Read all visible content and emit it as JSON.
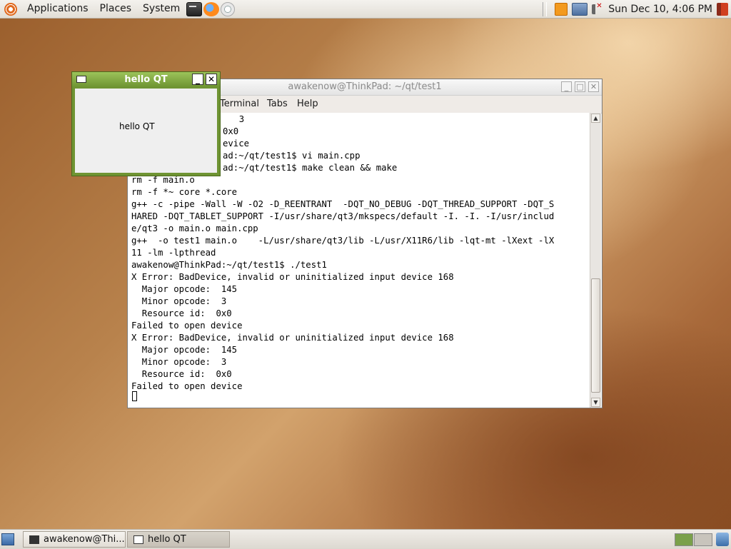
{
  "top_panel": {
    "menus": [
      "Applications",
      "Places",
      "System"
    ],
    "launchers": [
      "terminal-launcher-icon",
      "firefox-icon",
      "evolution-mail-icon"
    ],
    "tray": [
      "update-notifier-icon",
      "network-icon",
      "volume-muted-icon"
    ],
    "clock": "Sun Dec 10,  4:06 PM",
    "logout": "logout-icon"
  },
  "terminal": {
    "title": "awakenow@ThinkPad: ~/qt/test1",
    "menu": {
      "terminal": "Terminal",
      "tabs": "Tabs",
      "help": "Help"
    },
    "lines": [
      "  3",
      "0x0",
      "evice",
      "ad:~/qt/test1$ vi main.cpp",
      "ad:~/qt/test1$ make clean && make",
      "rm -f main.o",
      "rm -f *~ core *.core",
      "g++ -c -pipe -Wall -W -O2 -D_REENTRANT  -DQT_NO_DEBUG -DQT_THREAD_SUPPORT -DQT_S",
      "HARED -DQT_TABLET_SUPPORT -I/usr/share/qt3/mkspecs/default -I. -I. -I/usr/includ",
      "e/qt3 -o main.o main.cpp",
      "g++  -o test1 main.o    -L/usr/share/qt3/lib -L/usr/X11R6/lib -lqt-mt -lXext -lX",
      "11 -lm -lpthread",
      "awakenow@ThinkPad:~/qt/test1$ ./test1",
      "X Error: BadDevice, invalid or uninitialized input device 168",
      "  Major opcode:  145",
      "  Minor opcode:  3",
      "  Resource id:  0x0",
      "Failed to open device",
      "X Error: BadDevice, invalid or uninitialized input device 168",
      "  Major opcode:  145",
      "  Minor opcode:  3",
      "  Resource id:  0x0",
      "Failed to open device"
    ]
  },
  "qt_window": {
    "title": "hello QT",
    "label": "hello QT"
  },
  "taskbar": {
    "tasks": [
      "awakenow@Thi...",
      "hello QT"
    ]
  }
}
